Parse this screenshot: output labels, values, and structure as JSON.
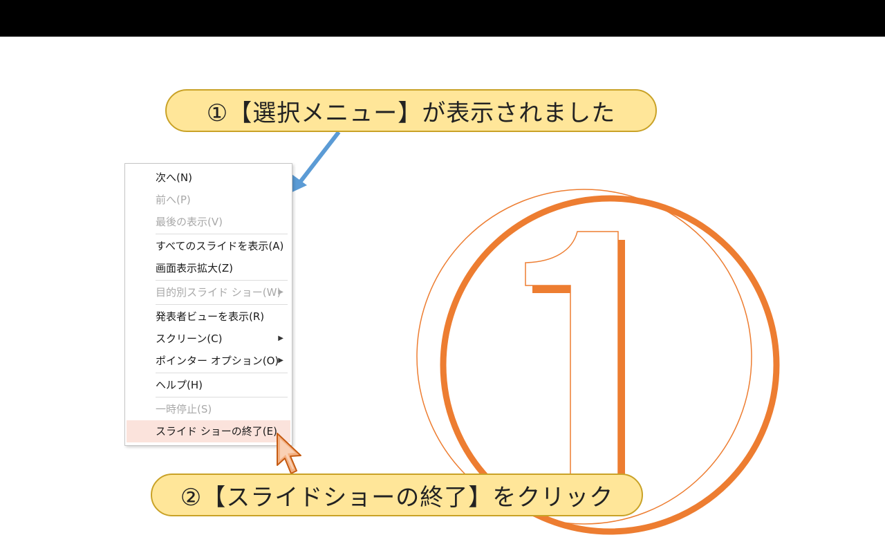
{
  "callouts": {
    "step1": "①【選択メニュー】が表示されました",
    "step2": "②【スライドショーの終了】をクリック"
  },
  "menu": {
    "items": [
      {
        "label": "次へ(N)",
        "enabled": true
      },
      {
        "label": "前へ(P)",
        "enabled": false
      },
      {
        "label": "最後の表示(V)",
        "enabled": false
      },
      {
        "label": "すべてのスライドを表示(A)",
        "enabled": true
      },
      {
        "label": "画面表示拡大(Z)",
        "enabled": true
      },
      {
        "label": "目的別スライド ショー(W)",
        "enabled": false,
        "submenu": true
      },
      {
        "label": "発表者ビューを表示(R)",
        "enabled": true
      },
      {
        "label": "スクリーン(C)",
        "enabled": true,
        "submenu": true
      },
      {
        "label": "ポインター オプション(O)",
        "enabled": true,
        "submenu": true
      },
      {
        "label": "ヘルプ(H)",
        "enabled": true
      },
      {
        "label": "一時停止(S)",
        "enabled": false
      },
      {
        "label": "スライド ショーの終了(E)",
        "enabled": true,
        "highlighted": true
      }
    ],
    "submenu_glyph": "▶"
  },
  "colors": {
    "callout_fill": "#ffe699",
    "callout_border": "#c9a227",
    "accent_orange": "#ed7d31",
    "arrow_blue": "#5b9bd5",
    "highlight": "#fbe3dc"
  }
}
